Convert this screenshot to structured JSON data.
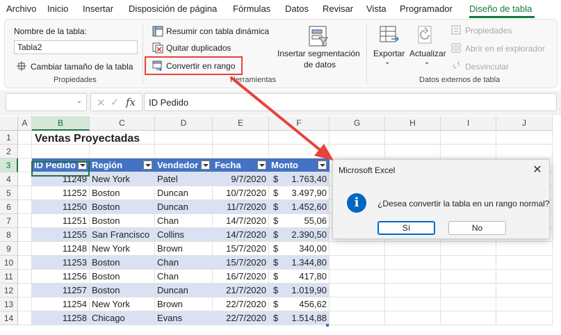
{
  "menu": {
    "tabs": [
      "Archivo",
      "Inicio",
      "Insertar",
      "Disposición de página",
      "Fórmulas",
      "Datos",
      "Revisar",
      "Vista",
      "Programador",
      "Diseño de tabla"
    ],
    "active_tab": "Diseño de tabla"
  },
  "ribbon": {
    "propiedades": {
      "table_name_label": "Nombre de la tabla:",
      "table_name_value": "Tabla2",
      "resize_label": "Cambiar tamaño de la tabla",
      "group_label": "Propiedades"
    },
    "herramientas": {
      "pivot_label": "Resumir con tabla dinámica",
      "remove_dup_label": "Quitar duplicados",
      "convert_label": "Convertir en rango",
      "slicer_label_1": "Insertar segmentación",
      "slicer_label_2": "de datos",
      "group_label": "Herramientas"
    },
    "datos_externos": {
      "export_label": "Exportar",
      "refresh_label": "Actualizar",
      "properties_label": "Propiedades",
      "open_browser_label": "Abrir en el explorador",
      "unlink_label": "Desvincular",
      "group_label": "Datos externos de tabla"
    }
  },
  "formula_bar": {
    "name_box": "",
    "fx_symbol": "fx",
    "content": "ID Pedido"
  },
  "sheet": {
    "columns": [
      "A",
      "B",
      "C",
      "D",
      "E",
      "F",
      "G",
      "H",
      "I",
      "J"
    ],
    "rows": [
      "1",
      "2",
      "3",
      "4",
      "5",
      "6",
      "7",
      "8",
      "9",
      "10",
      "11",
      "12",
      "13",
      "14"
    ],
    "title": "Ventas Proyectadas",
    "table_headers": [
      "ID Pedido",
      "Región",
      "Vendedor",
      "Fecha",
      "Monto"
    ],
    "table_rows": [
      [
        "11249",
        "New York",
        "Patel",
        "9/7/2020",
        "$",
        "1.763,40"
      ],
      [
        "11252",
        "Boston",
        "Duncan",
        "10/7/2020",
        "$",
        "3.497,90"
      ],
      [
        "11250",
        "Boston",
        "Duncan",
        "11/7/2020",
        "$",
        "1.452,60"
      ],
      [
        "11251",
        "Boston",
        "Chan",
        "14/7/2020",
        "$",
        "55,06"
      ],
      [
        "11255",
        "San Francisco",
        "Collins",
        "14/7/2020",
        "$",
        "2.390,50"
      ],
      [
        "11248",
        "New York",
        "Brown",
        "15/7/2020",
        "$",
        "340,00"
      ],
      [
        "11253",
        "Boston",
        "Chan",
        "15/7/2020",
        "$",
        "1.344,80"
      ],
      [
        "11256",
        "Boston",
        "Chan",
        "16/7/2020",
        "$",
        "417,80"
      ],
      [
        "11257",
        "Boston",
        "Duncan",
        "21/7/2020",
        "$",
        "1.019,90"
      ],
      [
        "11254",
        "New York",
        "Brown",
        "22/7/2020",
        "$",
        "456,62"
      ],
      [
        "11258",
        "Chicago",
        "Evans",
        "22/7/2020",
        "$",
        "1.514,88"
      ]
    ]
  },
  "dialog": {
    "title": "Microsoft Excel",
    "close_symbol": "✕",
    "message": "¿Desea convertir la tabla en un rango normal?",
    "yes_label": "Sí",
    "no_label": "No",
    "info_symbol": "i"
  },
  "colors": {
    "accent_green": "#0f7b3f",
    "table_header": "#4472c4",
    "table_band": "#d9e1f2",
    "highlight_red": "#e8423a",
    "info_blue": "#0067c0"
  }
}
